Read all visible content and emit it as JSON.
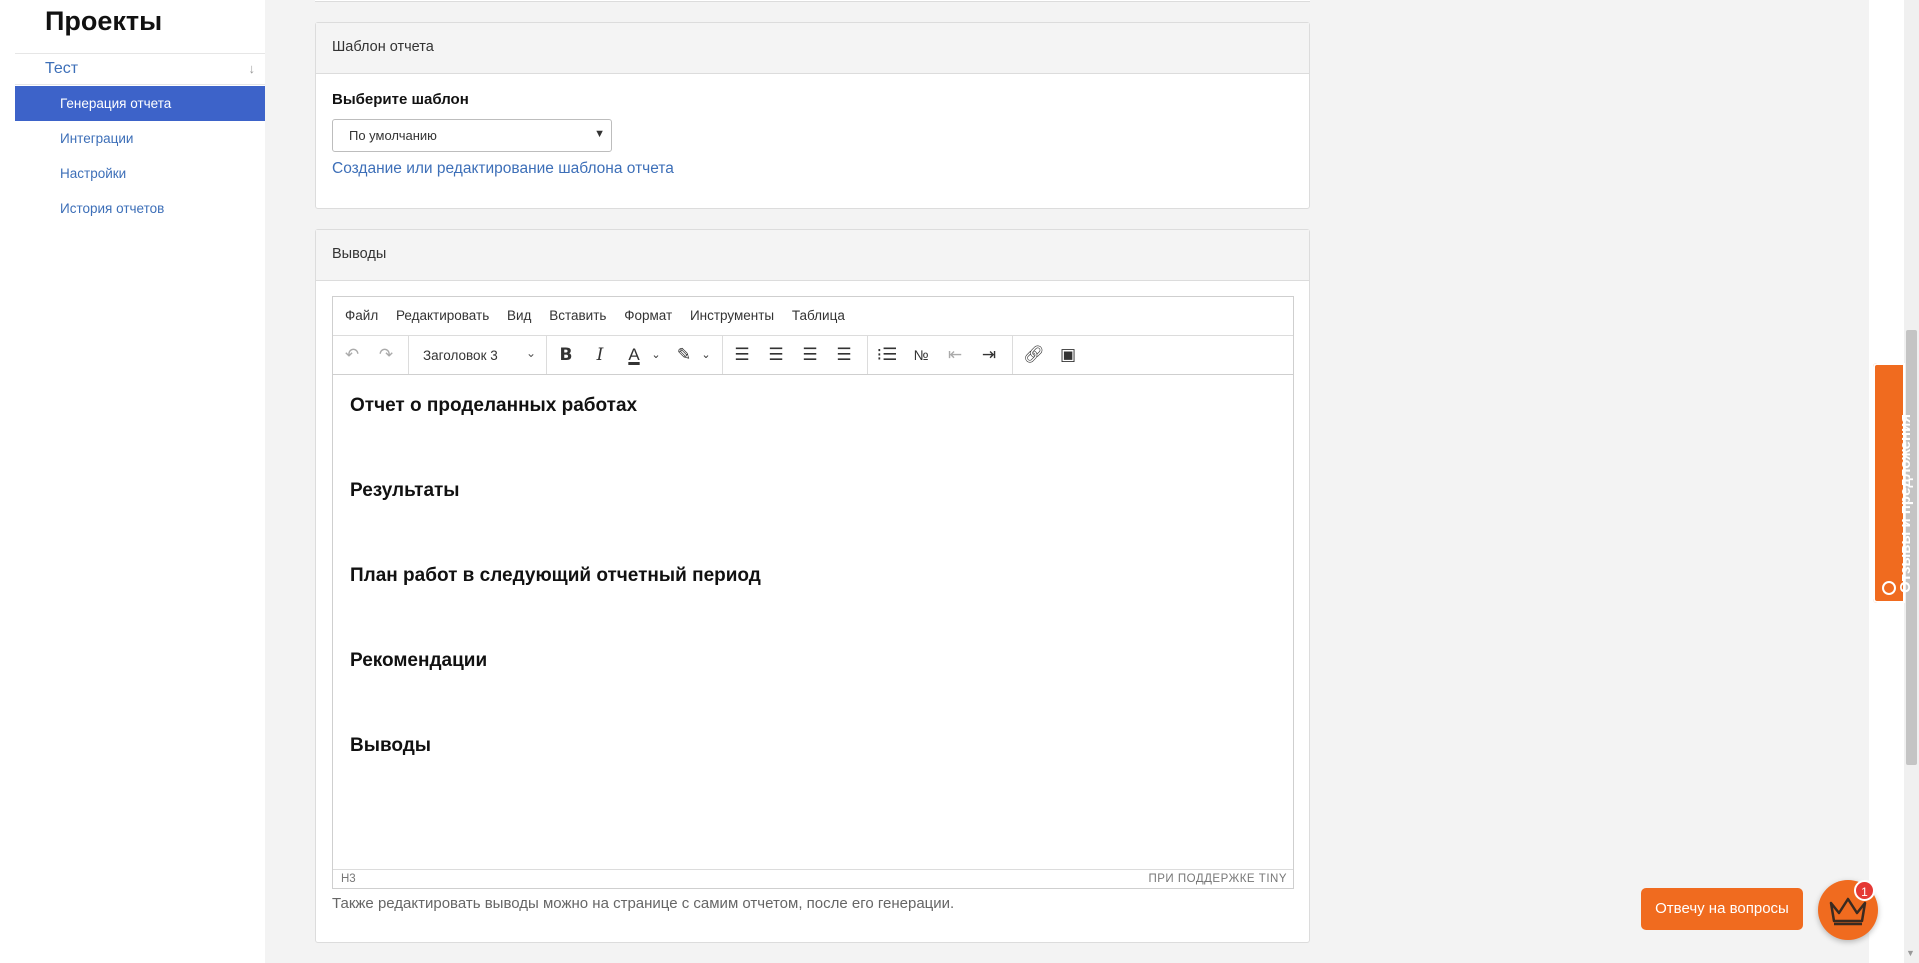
{
  "sidebar": {
    "title": "Проекты",
    "project": "Тест",
    "items": [
      {
        "label": "Генерация отчета",
        "active": true
      },
      {
        "label": "Интеграции",
        "active": false
      },
      {
        "label": "Настройки",
        "active": false
      },
      {
        "label": "История отчетов",
        "active": false
      }
    ]
  },
  "template_card": {
    "header": "Шаблон отчета",
    "select_label": "Выберите шаблон",
    "select_value": "По умолчанию",
    "link": "Создание или редактирование шаблона отчета"
  },
  "conclusions_card": {
    "header": "Выводы",
    "menu": [
      "Файл",
      "Редактировать",
      "Вид",
      "Вставить",
      "Формат",
      "Инструменты",
      "Таблица"
    ],
    "format_value": "Заголовок 3",
    "headings": [
      "Отчет о проделанных работах",
      "Результаты",
      "План работ в следующий отчетный период",
      "Рекомендации",
      "Выводы"
    ],
    "status_path": "H3",
    "status_brand": "ПРИ ПОДДЕРЖКЕ TINY",
    "hint": "Также редактировать выводы можно на странице с самим отчетом, после его генерации."
  },
  "feedback_tab": "Отзывы и предложения",
  "chat": {
    "button": "Отвечу на вопросы",
    "badge": "1"
  },
  "colors": {
    "accent": "#f06b1f",
    "link": "#3d6fb8",
    "active_nav": "#3d63c9"
  }
}
